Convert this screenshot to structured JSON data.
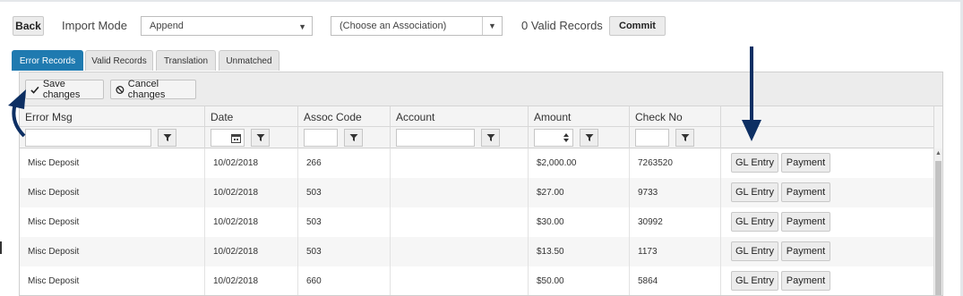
{
  "toolbar": {
    "back_label": "Back",
    "import_mode_label": "Import Mode",
    "import_mode_value": "Append",
    "association_value": "(Choose an Association)",
    "valid_records_text": "0 Valid Records",
    "commit_label": "Commit"
  },
  "tabs": [
    {
      "label": "Error Records",
      "active": true
    },
    {
      "label": "Valid Records",
      "active": false
    },
    {
      "label": "Translation",
      "active": false
    },
    {
      "label": "Unmatched",
      "active": false
    }
  ],
  "grid_toolbar": {
    "save_label": "Save changes",
    "cancel_label": "Cancel changes"
  },
  "columns": [
    "Error Msg",
    "Date",
    "Assoc Code",
    "Account",
    "Amount",
    "Check No",
    ""
  ],
  "rows": [
    {
      "error": "Misc Deposit",
      "date": "10/02/2018",
      "assoc": "266",
      "account": "",
      "amount": "$2,000.00",
      "check": "7263520",
      "gl": "GL Entry",
      "pay": "Payment"
    },
    {
      "error": "Misc Deposit",
      "date": "10/02/2018",
      "assoc": "503",
      "account": "",
      "amount": "$27.00",
      "check": "9733",
      "gl": "GL Entry",
      "pay": "Payment"
    },
    {
      "error": "Misc Deposit",
      "date": "10/02/2018",
      "assoc": "503",
      "account": "",
      "amount": "$30.00",
      "check": "30992",
      "gl": "GL Entry",
      "pay": "Payment"
    },
    {
      "error": "Misc Deposit",
      "date": "10/02/2018",
      "assoc": "503",
      "account": "",
      "amount": "$13.50",
      "check": "1173",
      "gl": "GL Entry",
      "pay": "Payment"
    },
    {
      "error": "Misc Deposit",
      "date": "10/02/2018",
      "assoc": "660",
      "account": "",
      "amount": "$50.00",
      "check": "5864",
      "gl": "GL Entry",
      "pay": "Payment"
    }
  ],
  "colors": {
    "active_tab": "#1f7ab0",
    "annotation_arrow": "#0d2f63"
  },
  "icons": {
    "filter": "filter-icon",
    "calendar": "calendar-icon",
    "save": "check-icon",
    "cancel": "ban-icon",
    "dropdown": "chevron-down-icon",
    "spinner": "spinner-icon"
  }
}
